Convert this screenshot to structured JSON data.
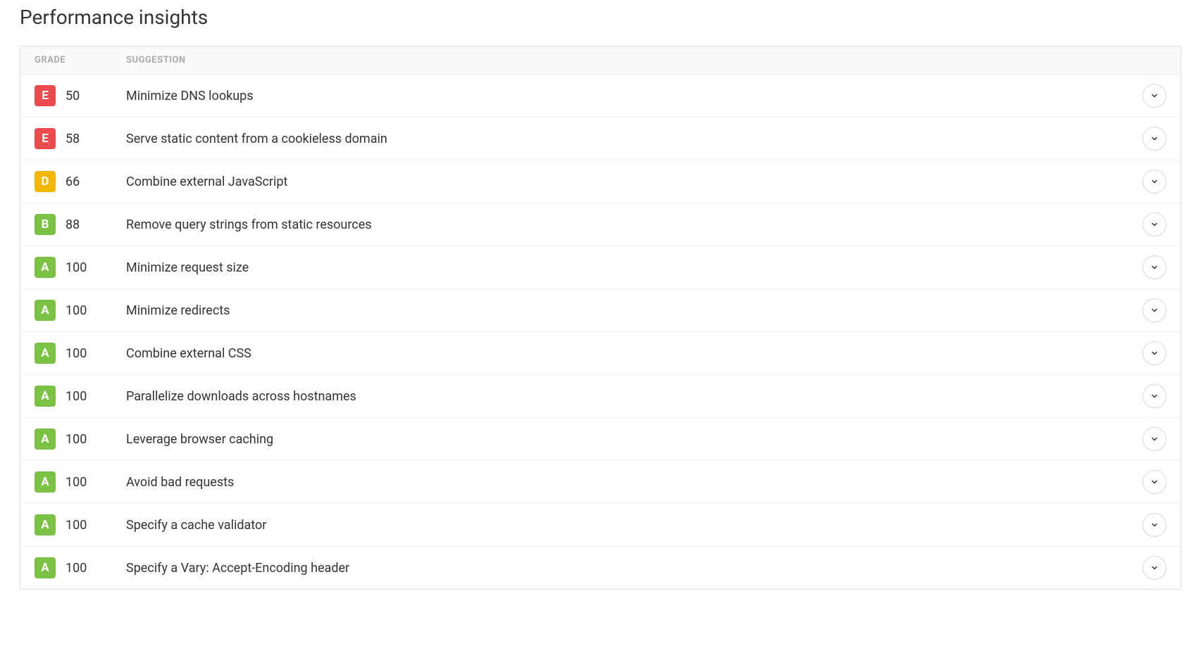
{
  "title": "Performance insights",
  "headers": {
    "grade": "GRADE",
    "suggestion": "SUGGESTION"
  },
  "rows": [
    {
      "grade": "E",
      "score": "50",
      "suggestion": "Minimize DNS lookups"
    },
    {
      "grade": "E",
      "score": "58",
      "suggestion": "Serve static content from a cookieless domain"
    },
    {
      "grade": "D",
      "score": "66",
      "suggestion": "Combine external JavaScript"
    },
    {
      "grade": "B",
      "score": "88",
      "suggestion": "Remove query strings from static resources"
    },
    {
      "grade": "A",
      "score": "100",
      "suggestion": "Minimize request size"
    },
    {
      "grade": "A",
      "score": "100",
      "suggestion": "Minimize redirects"
    },
    {
      "grade": "A",
      "score": "100",
      "suggestion": "Combine external CSS"
    },
    {
      "grade": "A",
      "score": "100",
      "suggestion": "Parallelize downloads across hostnames"
    },
    {
      "grade": "A",
      "score": "100",
      "suggestion": "Leverage browser caching"
    },
    {
      "grade": "A",
      "score": "100",
      "suggestion": "Avoid bad requests"
    },
    {
      "grade": "A",
      "score": "100",
      "suggestion": "Specify a cache validator"
    },
    {
      "grade": "A",
      "score": "100",
      "suggestion": "Specify a Vary: Accept-Encoding header"
    }
  ]
}
